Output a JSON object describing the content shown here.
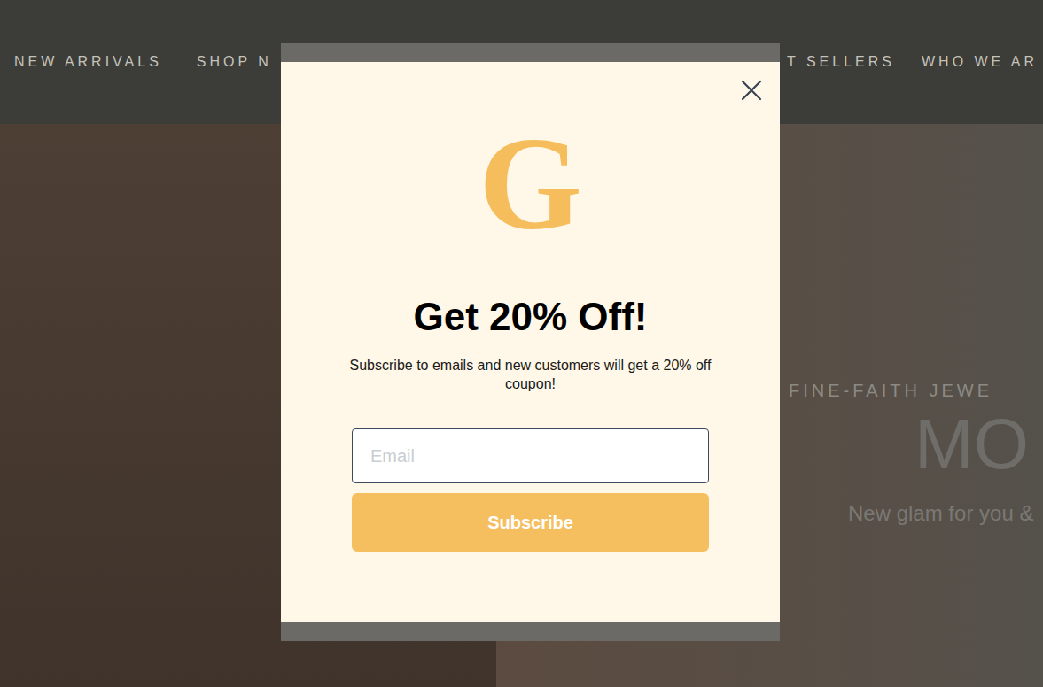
{
  "nav": {
    "items": [
      "NEW ARRIVALS",
      "SHOP N",
      "T SELLERS",
      "WHO WE AR"
    ]
  },
  "hero": {
    "eyebrow": "FINE-FAITH JEWE",
    "title": "MO",
    "subtitle": "New glam for you &"
  },
  "modal": {
    "logo": "G",
    "title": "Get 20% Off!",
    "text": "Subscribe to emails and new customers will get a 20% off coupon!",
    "email_placeholder": "Email",
    "button": "Subscribe"
  }
}
